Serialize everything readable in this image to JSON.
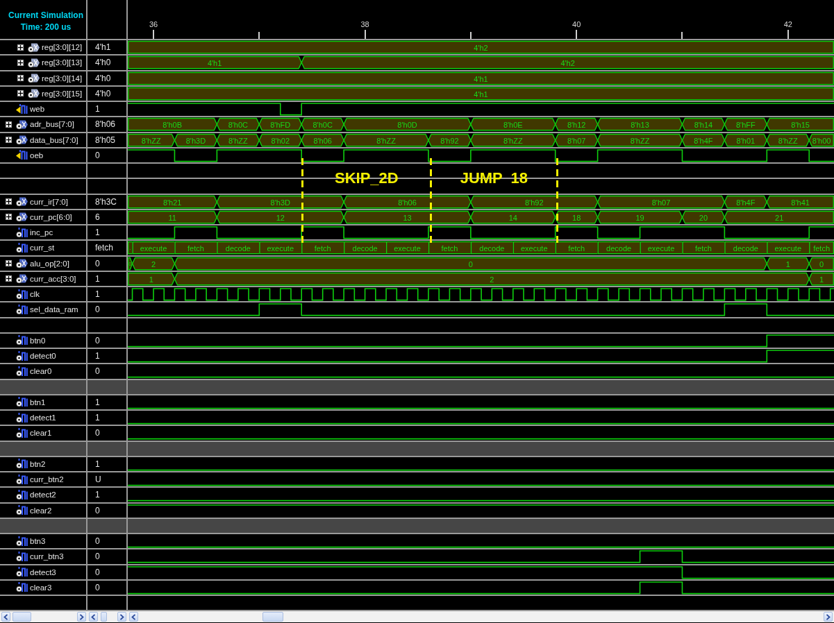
{
  "header": {
    "title": "Current Simulation Time: 200 us"
  },
  "time_axis": {
    "ticks": [
      "36",
      "38",
      "40",
      "42"
    ]
  },
  "signals": [
    {
      "name": "reg[3:0][12]",
      "value": "4'h1",
      "kind": "element",
      "expanded": false,
      "segments": [
        "4'h2"
      ]
    },
    {
      "name": "reg[3:0][13]",
      "value": "4'h0",
      "kind": "element",
      "expanded": false,
      "segments": [
        "4'h1",
        "4'h2"
      ]
    },
    {
      "name": "reg[3:0][14]",
      "value": "4'h0",
      "kind": "element",
      "expanded": false,
      "segments": [
        "4'h1"
      ]
    },
    {
      "name": "reg[3:0][15]",
      "value": "4'h0",
      "kind": "element",
      "expanded": false,
      "segments": [
        "4'h1"
      ]
    },
    {
      "name": "web",
      "value": "1",
      "kind": "port"
    },
    {
      "name": "adr_bus[7:0]",
      "value": "8'h06",
      "kind": "bus",
      "expanded": false,
      "segments": [
        "8'h0B",
        "8'h0C",
        "8'hFD",
        "8'h0C",
        "8'h0D",
        "8'h0E",
        "8'h12",
        "8'h13",
        "8'h14",
        "8'hFF",
        "8'h15"
      ]
    },
    {
      "name": "data_bus[7:0]",
      "value": "8'h05",
      "kind": "bus",
      "expanded": false,
      "segments": [
        "8'hZZ",
        "8'h3D",
        "8'hZZ",
        "8'h02",
        "8'h06",
        "8'hZZ",
        "8'h92",
        "8'hZZ",
        "8'h07",
        "8'hZZ",
        "8'h4F",
        "8'h01",
        "8'hZZ",
        "8'h00"
      ]
    },
    {
      "name": "oeb",
      "value": "0",
      "kind": "port"
    },
    {
      "kind": "spacer"
    },
    {
      "kind": "spacer"
    },
    {
      "name": "curr_ir[7:0]",
      "value": "8'h3C",
      "kind": "bus",
      "expanded": false,
      "segments": [
        "8'h21",
        "8'h3D",
        "8'h06",
        "8'h92",
        "8'h07",
        "8'h4F",
        "8'h41"
      ]
    },
    {
      "name": "curr_pc[6:0]",
      "value": "6",
      "kind": "bus",
      "expanded": false,
      "segments": [
        "11",
        "12",
        "13",
        "14",
        "18",
        "19",
        "20",
        "21"
      ]
    },
    {
      "name": "inc_pc",
      "value": "1",
      "kind": "bit"
    },
    {
      "name": "curr_st",
      "value": "fetch",
      "kind": "enum",
      "segments": [
        ".",
        "execute",
        "fetch",
        "decode",
        "execute",
        "fetch",
        "decode",
        "execute",
        "fetch",
        "decode",
        "execute",
        "fetch",
        "decode",
        "execute",
        "fetch",
        "decode",
        "execute",
        "fetch"
      ]
    },
    {
      "name": "alu_op[2:0]",
      "value": "0",
      "kind": "bus",
      "expanded": false,
      "segments": [
        "0",
        "2",
        "0",
        "1",
        "0"
      ]
    },
    {
      "name": "curr_acc[3:0]",
      "value": "1",
      "kind": "bus",
      "expanded": false,
      "segments": [
        "1",
        "2",
        "1"
      ]
    },
    {
      "name": "clk",
      "value": "1",
      "kind": "clock"
    },
    {
      "name": "sel_data_ram",
      "value": "0",
      "kind": "bit"
    },
    {
      "kind": "spacer"
    },
    {
      "name": "btn0",
      "value": "0",
      "kind": "bit"
    },
    {
      "name": "detect0",
      "value": "1",
      "kind": "bit"
    },
    {
      "name": "clear0",
      "value": "0",
      "kind": "bit"
    },
    {
      "kind": "band"
    },
    {
      "name": "btn1",
      "value": "1",
      "kind": "bit"
    },
    {
      "name": "detect1",
      "value": "1",
      "kind": "bit"
    },
    {
      "name": "clear1",
      "value": "0",
      "kind": "bit"
    },
    {
      "kind": "band"
    },
    {
      "name": "btn2",
      "value": "1",
      "kind": "bit"
    },
    {
      "name": "curr_btn2",
      "value": "U",
      "kind": "bit"
    },
    {
      "name": "detect2",
      "value": "1",
      "kind": "bit"
    },
    {
      "name": "clear2",
      "value": "0",
      "kind": "bit"
    },
    {
      "kind": "band"
    },
    {
      "name": "btn3",
      "value": "0",
      "kind": "bit"
    },
    {
      "name": "curr_btn3",
      "value": "0",
      "kind": "bit"
    },
    {
      "name": "detect3",
      "value": "0",
      "kind": "bit"
    },
    {
      "name": "clear3",
      "value": "0",
      "kind": "bit"
    },
    {
      "kind": "spacer"
    }
  ],
  "annotations": [
    "SKIP_2D",
    "JUMP  18"
  ]
}
